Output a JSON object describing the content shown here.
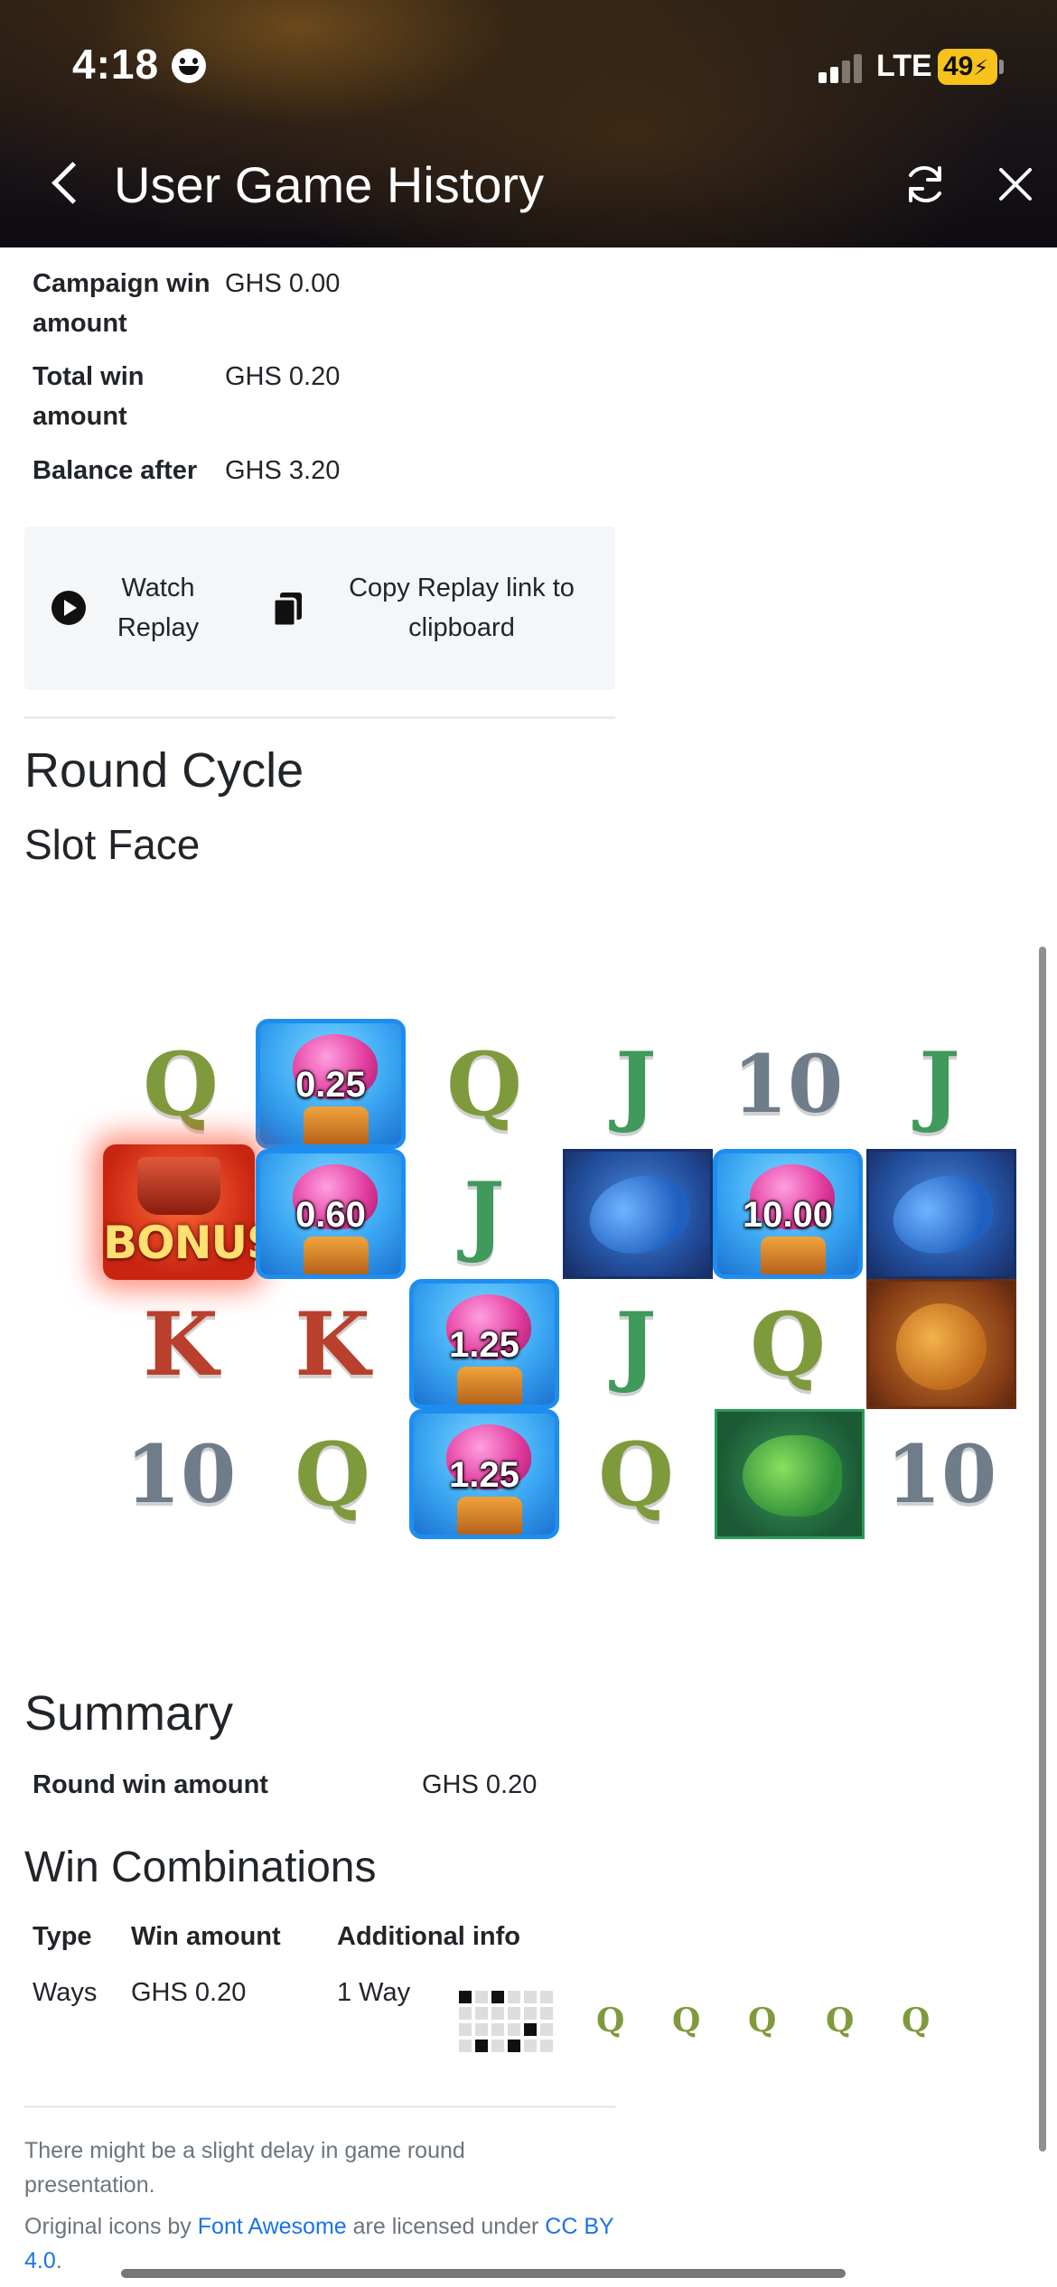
{
  "status_bar": {
    "time": "4:18",
    "network": "LTE",
    "battery": "49"
  },
  "header": {
    "title": "User Game History"
  },
  "round_info": [
    {
      "label": "Campaign win amount",
      "value": "GHS 0.00"
    },
    {
      "label": "Total win amount",
      "value": "GHS 0.20"
    },
    {
      "label": "Balance after",
      "value": "GHS 3.20"
    }
  ],
  "replay": {
    "watch_label": "Watch Replay",
    "copy_label": "Copy Replay link to clipboard"
  },
  "round_cycle": {
    "title": "Round Cycle",
    "subtitle": "Slot Face"
  },
  "slot_face": {
    "bonus_label": "BONUS",
    "symbols": {
      "q": "Q",
      "j": "J",
      "k": "K",
      "ten": "10"
    },
    "multipliers": [
      "0.25",
      "0.60",
      "10.00",
      "1.25",
      "1.25"
    ]
  },
  "summary": {
    "title": "Summary",
    "round_win_label": "Round win amount",
    "round_win_value": "GHS 0.20"
  },
  "win_combinations": {
    "title": "Win Combinations",
    "headers": [
      "Type",
      "Win amount",
      "Additional info"
    ],
    "rows": [
      {
        "type": "Ways",
        "win_amount": "GHS 0.20",
        "info": "1 Way"
      }
    ],
    "symbol": "Q"
  },
  "footer": {
    "delay_note": "There might be a slight delay in game round presentation.",
    "license_prefix": "Original icons by",
    "license_link": "Font Awesome",
    "license_mid": "are licensed under",
    "license_cc": "CC BY 4.0"
  },
  "colors": {
    "link": "#1a73e8",
    "accent_tile": "#1d8ef0",
    "battery": "#f6c21b"
  }
}
